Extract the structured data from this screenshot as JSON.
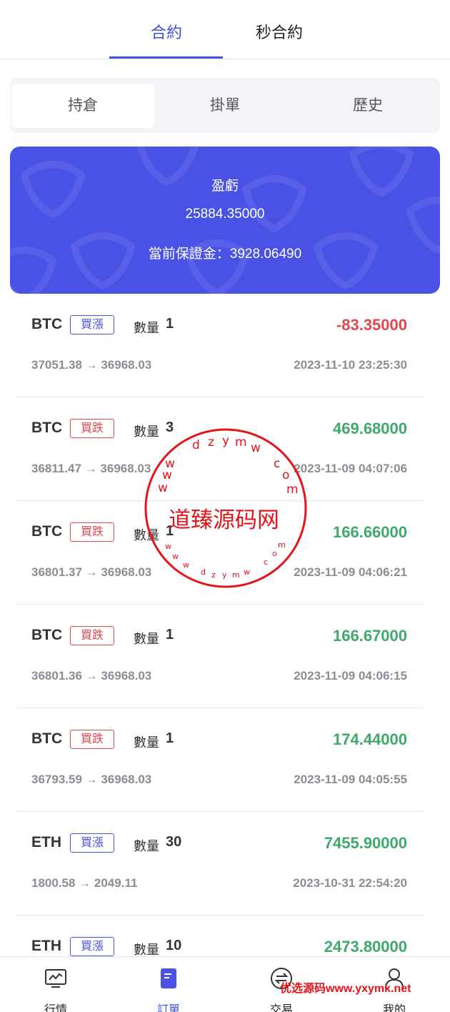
{
  "top_tabs": [
    {
      "label": "合約",
      "active": true
    },
    {
      "label": "秒合約",
      "active": false
    }
  ],
  "sub_tabs": [
    {
      "label": "持倉",
      "active": true
    },
    {
      "label": "掛單",
      "active": false
    },
    {
      "label": "歷史",
      "active": false
    }
  ],
  "summary": {
    "pnl_label": "盈虧",
    "pnl_value": "25884.35000",
    "margin_text": "當前保證金：3928.06490"
  },
  "qty_label": "數量",
  "orders": [
    {
      "symbol": "BTC",
      "side": "買漲",
      "side_type": "up",
      "qty": "1",
      "pnl": "-83.35000",
      "pnl_sign": "neg",
      "prices": "37051.38 → 36968.03",
      "time": "2023-11-10 23:25:30"
    },
    {
      "symbol": "BTC",
      "side": "買跌",
      "side_type": "down",
      "qty": "3",
      "pnl": "469.68000",
      "pnl_sign": "pos",
      "prices": "36811.47 → 36968.03",
      "time": "2023-11-09 04:07:06"
    },
    {
      "symbol": "BTC",
      "side": "買跌",
      "side_type": "down",
      "qty": "1",
      "pnl": "166.66000",
      "pnl_sign": "pos",
      "prices": "36801.37 → 36968.03",
      "time": "2023-11-09 04:06:21"
    },
    {
      "symbol": "BTC",
      "side": "買跌",
      "side_type": "down",
      "qty": "1",
      "pnl": "166.67000",
      "pnl_sign": "pos",
      "prices": "36801.36 → 36968.03",
      "time": "2023-11-09 04:06:15"
    },
    {
      "symbol": "BTC",
      "side": "買跌",
      "side_type": "down",
      "qty": "1",
      "pnl": "174.44000",
      "pnl_sign": "pos",
      "prices": "36793.59 → 36968.03",
      "time": "2023-11-09 04:05:55"
    },
    {
      "symbol": "ETH",
      "side": "買漲",
      "side_type": "up",
      "qty": "30",
      "pnl": "7455.90000",
      "pnl_sign": "pos",
      "prices": "1800.58 → 2049.11",
      "time": "2023-10-31 22:54:20"
    },
    {
      "symbol": "ETH",
      "side": "買漲",
      "side_type": "up",
      "qty": "10",
      "pnl": "2473.80000",
      "pnl_sign": "pos",
      "prices": "",
      "time": ""
    }
  ],
  "bottom_nav": [
    {
      "label": "行情",
      "icon": "chart-icon",
      "active": false
    },
    {
      "label": "訂單",
      "icon": "document-icon",
      "active": true
    },
    {
      "label": "交易",
      "icon": "exchange-icon",
      "active": false
    },
    {
      "label": "我的",
      "icon": "user-icon",
      "active": false
    }
  ],
  "watermark": {
    "stamp_title": "道臻源码网",
    "stamp_url": "www.dzymw.com",
    "bottom_text": "优选源码www.yxymk.net"
  },
  "colors": {
    "accent": "#3f4fe0",
    "card": "#4a52e6",
    "loss": "#e0464f",
    "gain": "#3fa96b"
  }
}
